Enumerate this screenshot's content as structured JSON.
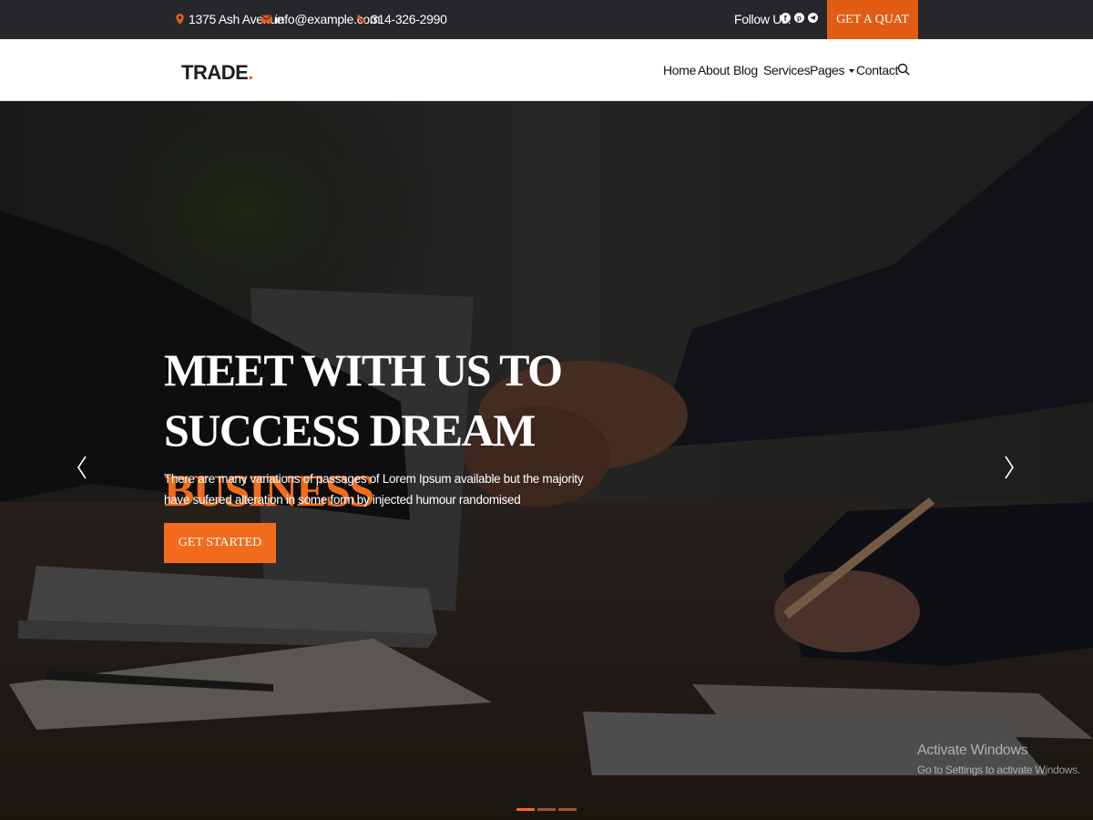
{
  "topbar": {
    "address": "1375 Ash Avenue",
    "email": "info@example.com",
    "phone": "314-326-2990",
    "follow_label": "Follow Us:",
    "social_icons": [
      "facebook-icon",
      "pinterest-icon",
      "telegram-icon"
    ],
    "quote_button": "GET A QUAT"
  },
  "navbar": {
    "logo_text": "TRADE",
    "logo_dot": ".",
    "items": [
      "Home",
      "About",
      "Blog",
      "Services",
      "Pages",
      "Contact"
    ]
  },
  "hero": {
    "title_line1": "MEET WITH US TO",
    "title_line2": "SUCCESS DREAM",
    "title_accent": "BUSINESS",
    "description": "There are many variations of passages of Lorem Ipsum available but the majority have sufered alteration in some form by injected humour randomised",
    "cta_label": "GET STARTED",
    "active_slide": 1,
    "slide_count": 3
  },
  "watermark": {
    "title": "Activate Windows",
    "subtitle": "Go to Settings to activate Windows."
  },
  "colors": {
    "accent": "#f26b1d",
    "topbar_bg": "#25272b",
    "quote_bg": "#e35c13"
  }
}
